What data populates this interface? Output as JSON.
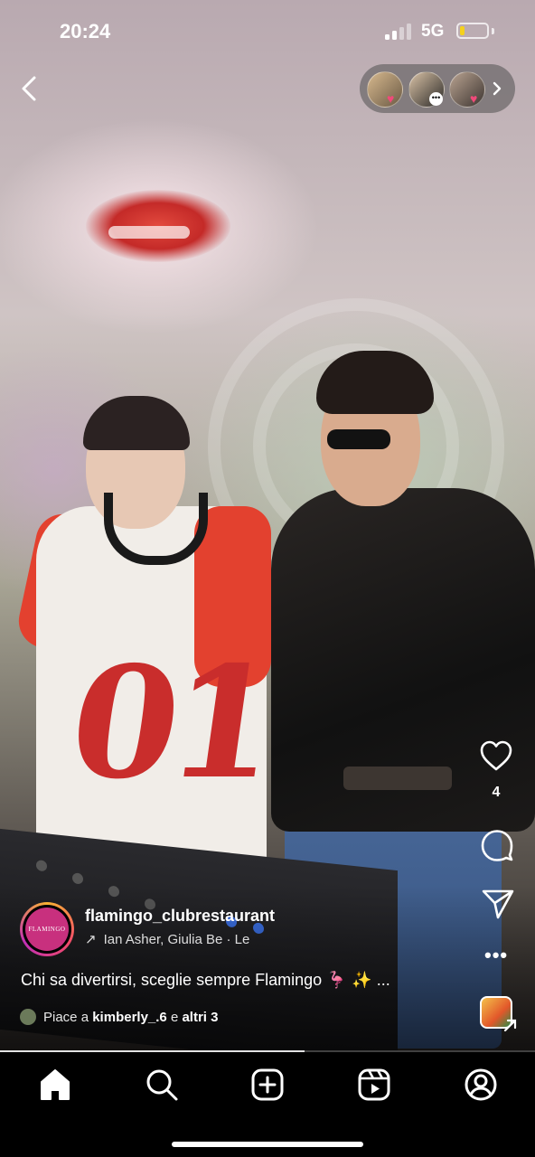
{
  "status_bar": {
    "time": "20:24",
    "network": "5G"
  },
  "viewers_pill": {
    "avatars": [
      {
        "badge": "heart"
      },
      {
        "badge": "message"
      },
      {
        "badge": "heart"
      }
    ]
  },
  "post": {
    "username": "flamingo_clubrestaurant",
    "profile_logo_text": "FLAMINGO",
    "collaborators": "Ian Asher, Giulia Be · Le",
    "caption_text": "Chi sa divertirsi, sceglie sempre Flamingo",
    "caption_emojis": "🦩 ✨",
    "caption_more": "...",
    "likes_prefix": "Piace a",
    "likes_user": "kimberly_.6",
    "likes_joiner": "e",
    "likes_others": "altri 3"
  },
  "actions": {
    "like_count": "4",
    "more_label": "•••"
  },
  "video_progress": 0.57,
  "bottom_nav": [
    {
      "name": "home",
      "icon": "home-icon",
      "active": true
    },
    {
      "name": "search",
      "icon": "search-icon",
      "active": false
    },
    {
      "name": "create",
      "icon": "create-post-icon",
      "active": false
    },
    {
      "name": "reels",
      "icon": "reels-icon",
      "active": false
    },
    {
      "name": "profile",
      "icon": "profile-icon",
      "active": false
    }
  ],
  "colors": {
    "accent_red": "#e3412f",
    "story_ring": [
      "#f9b233",
      "#f24b6a",
      "#c02fb4"
    ],
    "heart_badge": "#f04a7a",
    "battery_low": "#f5d11c",
    "logo_bg": "#c8307e"
  }
}
